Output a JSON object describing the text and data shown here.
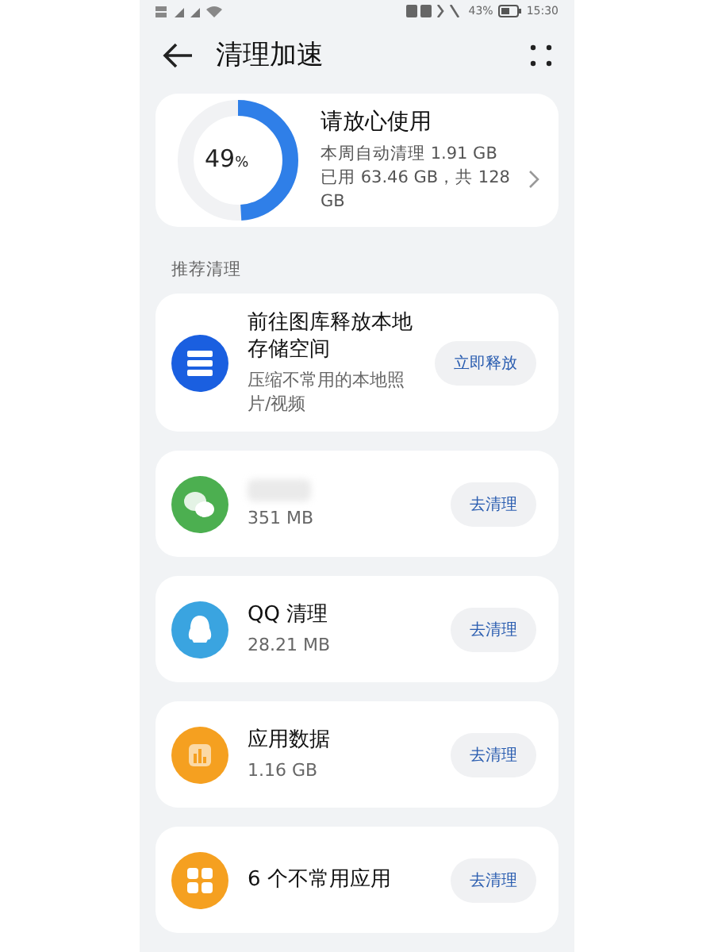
{
  "status_bar": {
    "battery": "43%",
    "time": "15:30"
  },
  "header": {
    "title": "清理加速"
  },
  "storage": {
    "percent": "49",
    "unit": "%",
    "title": "请放心使用",
    "lines": [
      "本周自动清理 1.91 GB",
      "已用 63.46 GB，共 128 GB"
    ]
  },
  "section_label": "推荐清理",
  "items": [
    {
      "kind": "gallery",
      "title": "前往图库释放本地存储空间",
      "subtitle": "压缩不常用的本地照片/视频",
      "button": "立即释放"
    },
    {
      "kind": "chat",
      "subtitle": "351 MB",
      "button": "去清理"
    },
    {
      "kind": "penguin",
      "title": "QQ 清理",
      "subtitle": "28.21 MB",
      "button": "去清理"
    },
    {
      "kind": "chart",
      "title": "应用数据",
      "subtitle": "1.16 GB",
      "button": "去清理"
    },
    {
      "kind": "apps",
      "title": "6 个不常用应用",
      "button": "去清理"
    }
  ]
}
